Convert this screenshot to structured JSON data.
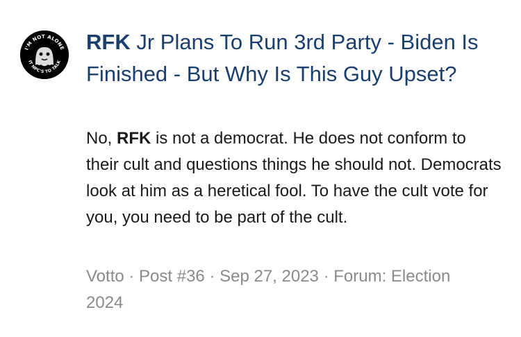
{
  "result": {
    "avatar": {
      "icon": "ghost-avatar-icon",
      "top_text": "I'M NOT ALONE",
      "bottom_text": "IT NPC'S TO TALK"
    },
    "title": {
      "highlight": "RFK",
      "rest": " Jr Plans To Run 3rd Party - Biden Is Finished - But Why Is This Guy Upset?"
    },
    "snippet": {
      "part1": "No, ",
      "highlight": "RFK",
      "part2": " is not a democrat. He does not conform to their cult and questions things he should not. Democrats look at him as a heretical fool. To have the cult vote for you, you need to be part of the cult."
    },
    "meta": {
      "author": "Votto",
      "separator": " · ",
      "post": "Post #36",
      "date": "Sep 27, 2023",
      "forum_label": "Forum:",
      "forum_name": "Election 2024"
    },
    "colors": {
      "title": "#1a3e6e",
      "text": "#1a1a1a",
      "meta": "#8a8a8a"
    }
  }
}
